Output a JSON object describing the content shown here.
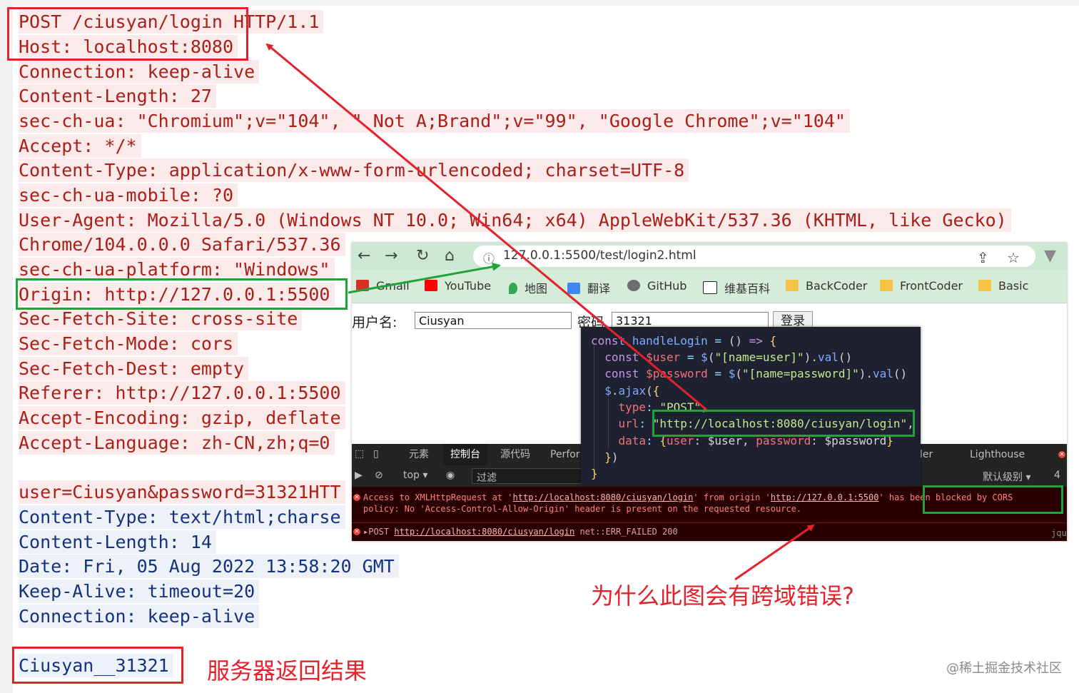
{
  "request_lines": [
    "POST /ciusyan/login HTTP/1.1",
    "Host: localhost:8080",
    "Connection: keep-alive",
    "Content-Length: 27",
    "sec-ch-ua: \"Chromium\";v=\"104\", \" Not A;Brand\";v=\"99\", \"Google Chrome\";v=\"104\"",
    "Accept: */*",
    "Content-Type: application/x-www-form-urlencoded; charset=UTF-8",
    "sec-ch-ua-mobile: ?0",
    "User-Agent: Mozilla/5.0 (Windows NT 10.0; Win64; x64) AppleWebKit/537.36 (KHTML, like Gecko)",
    "Chrome/104.0.0.0 Safari/537.36",
    "sec-ch-ua-platform: \"Windows\"",
    "Origin: http://127.0.0.1:5500",
    "Sec-Fetch-Site: cross-site",
    "Sec-Fetch-Mode: cors",
    "Sec-Fetch-Dest: empty",
    "Referer: http://127.0.0.1:5500",
    "Accept-Encoding: gzip, deflate",
    "Accept-Language: zh-CN,zh;q=0"
  ],
  "response_lines": [
    "user=Ciusyan&password=31321HTT",
    "Content-Type: text/html;charse",
    "Content-Length: 14",
    "Date: Fri, 05 Aug 2022 13:58:20 GMT",
    "Keep-Alive: timeout=20",
    "Connection: keep-alive"
  ],
  "server_result": "Ciusyan__31321",
  "annotations": {
    "server_result_label": "服务器返回结果",
    "question": "为什么此图会有跨域错误?",
    "watermark": "@稀土掘金技术社区"
  },
  "browser": {
    "url": "127.0.0.1:5500/test/login2.html",
    "bookmarks": [
      {
        "label": "Gmail",
        "color": "#d93025"
      },
      {
        "label": "YouTube",
        "color": "#ff0000"
      },
      {
        "label": "地图",
        "color": "#34a853"
      },
      {
        "label": "翻译",
        "color": "#4285f4"
      },
      {
        "label": "GitHub",
        "color": "#6e6e6e"
      },
      {
        "label": "维基百科",
        "color": "#222222"
      },
      {
        "label": "BackCoder",
        "color": "#f6c343"
      },
      {
        "label": "FrontCoder",
        "color": "#f6c343"
      },
      {
        "label": "Basic",
        "color": "#f6c343"
      }
    ],
    "form": {
      "username_label": "用户名:",
      "username_value": "Ciusyan",
      "password_label": "密码",
      "password_value": "31321",
      "login_button": "登录"
    },
    "devtools": {
      "tabs": [
        "元素",
        "控制台",
        "源代码",
        "Perfor",
        "ler",
        "Lighthouse"
      ],
      "active_tab": "控制台",
      "context": "top ▾",
      "filter_placeholder": "过滤",
      "level": "默认级别 ▾",
      "count": "4",
      "error_line1_a": "Access to XMLHttpRequest at '",
      "error_line1_url": "http://localhost:8080/ciusyan/login",
      "error_line1_b": "' from origin '",
      "error_line1_origin": "http://127.0.0.1:5500",
      "error_line1_c": "' has been blocked by CORS",
      "error_line2": "policy: No 'Access-Control-Allow-Origin' header is present on the requested resource.",
      "net_error_prefix": "▸POST ",
      "net_error_url": "http://localhost:8080/ciusyan/login",
      "net_error_suffix": " net::ERR_FAILED 200",
      "source_hint": "jqu"
    }
  },
  "code_lines": [
    "const handleLogin = () => {",
    "  const $user = $(\"[name=user]\").val()",
    "  const $password = $(\"[name=password]\").val()",
    "  $.ajax({",
    "    type: \"POST\",",
    "    url: \"http://localhost:8080/ciusyan/login\",",
    "    data: {user: $user, password: $password}",
    "  })",
    "}"
  ],
  "colors": {
    "request_text": "#a8201a",
    "response_text": "#16327a",
    "highlight_red": "#e4222b",
    "highlight_green": "#21a33a"
  }
}
